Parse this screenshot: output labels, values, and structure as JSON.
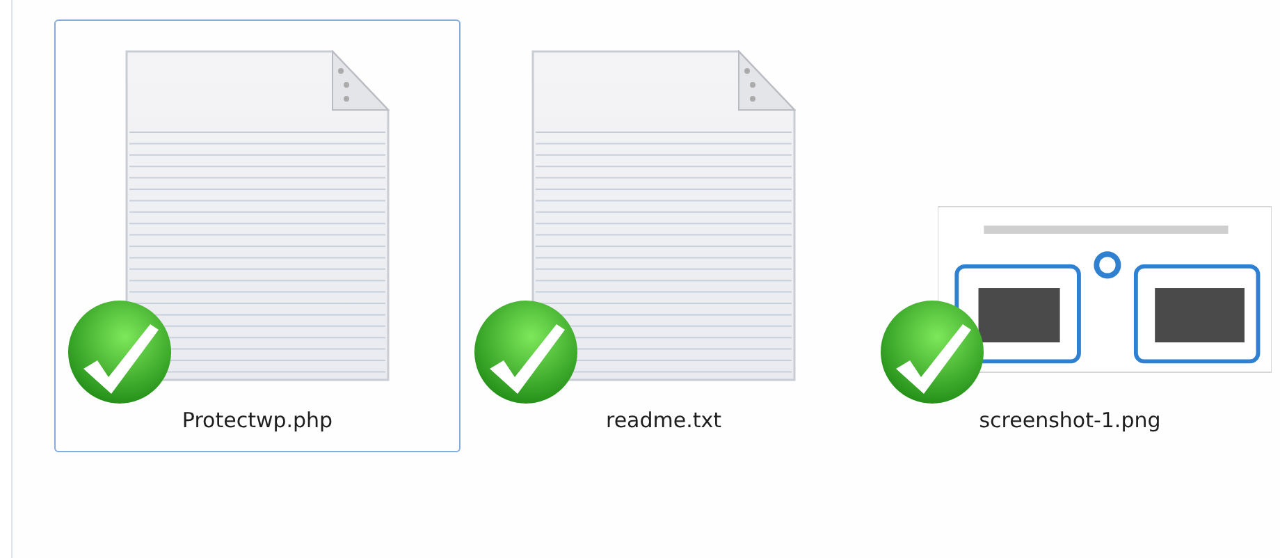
{
  "files": [
    {
      "name": "Protectwp.php",
      "kind": "document",
      "selected": true,
      "synced": true
    },
    {
      "name": "readme.txt",
      "kind": "document",
      "selected": false,
      "synced": true
    },
    {
      "name": "screenshot-1.png",
      "kind": "picture",
      "selected": false,
      "synced": true
    }
  ]
}
